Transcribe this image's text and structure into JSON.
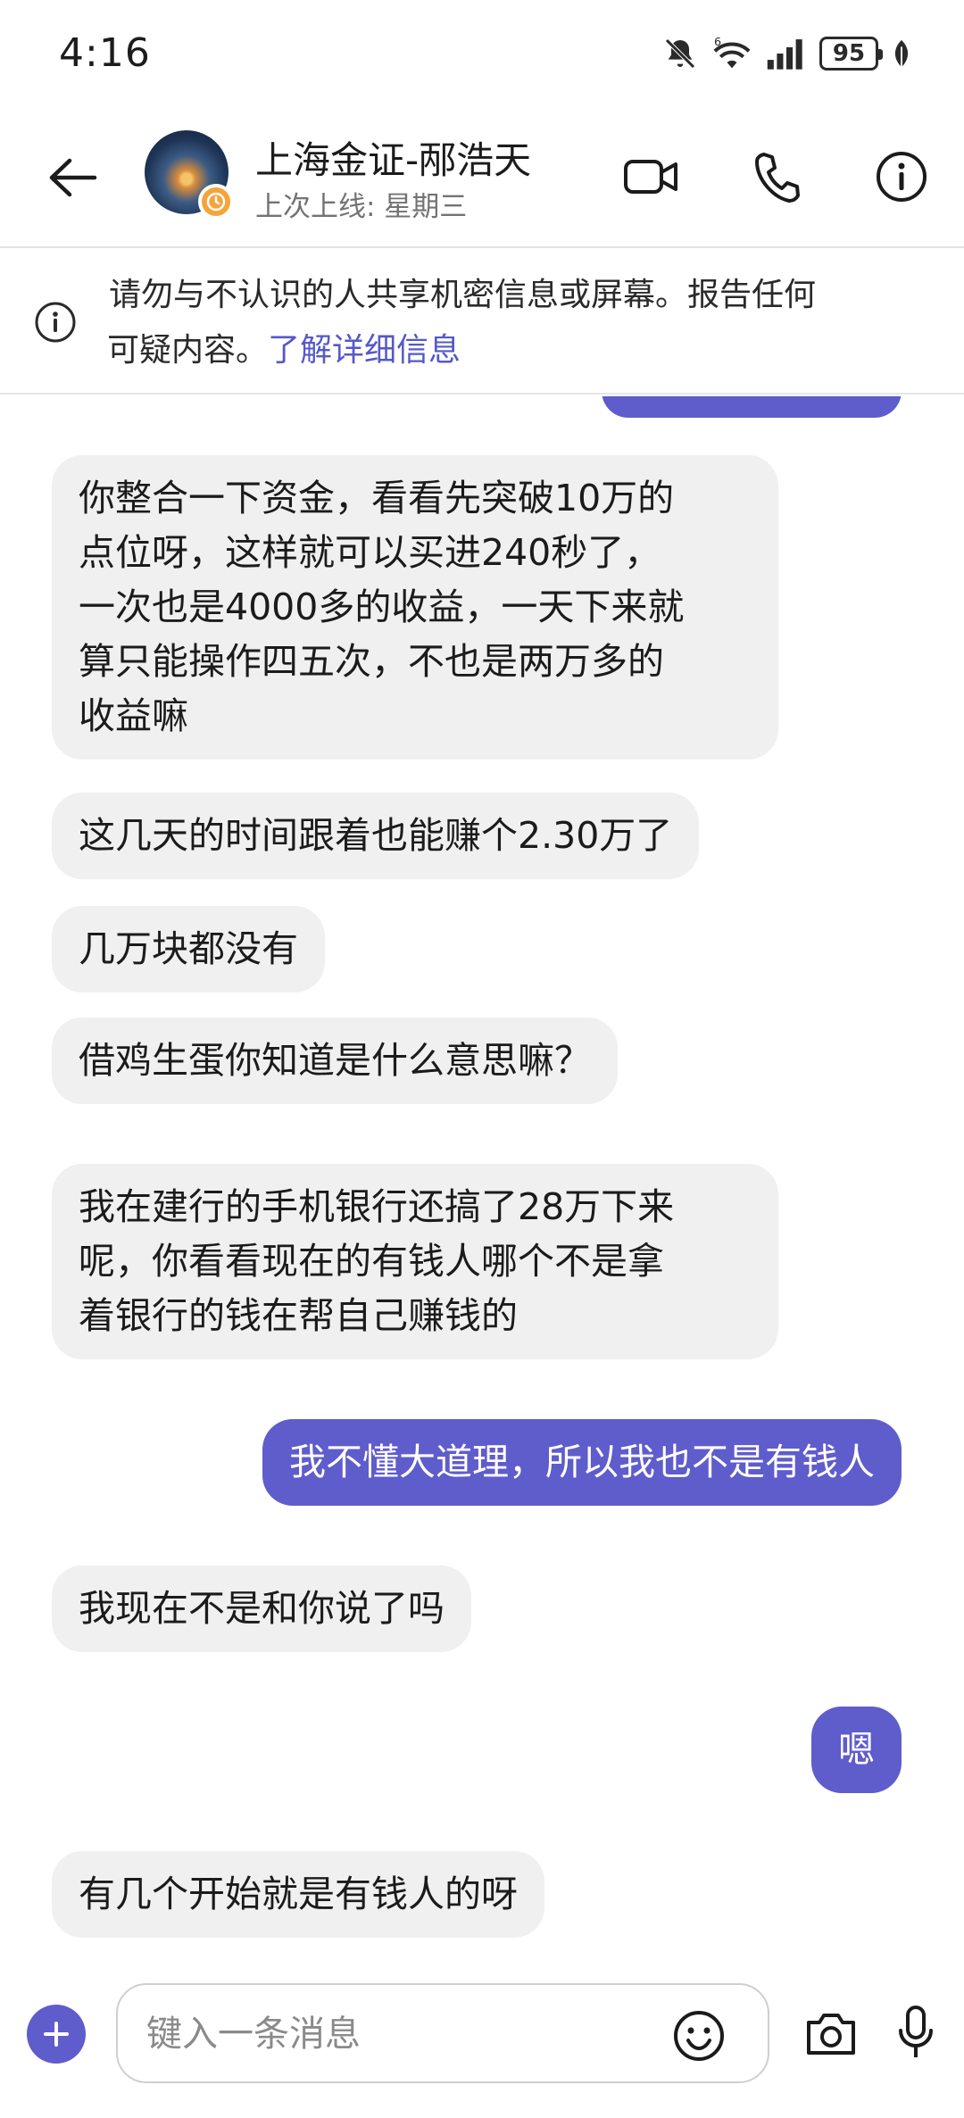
{
  "status_bar": {
    "time": "4:16",
    "battery": "95",
    "icons": [
      "mute-icon",
      "wifi-6-icon",
      "cell-signal-icon",
      "battery-icon",
      "leaf-icon"
    ]
  },
  "header": {
    "contact_name": "上海金证-邴浩天",
    "last_seen": "上次上线: 星期三",
    "icons": [
      "back-arrow-icon",
      "video-call-icon",
      "phone-icon",
      "info-icon"
    ]
  },
  "banner": {
    "text": "请勿与不认识的人共享机密信息或屏幕。报告任何可疑内容。",
    "line1": "请勿与不认识的人共享机密信息或屏幕。报告任何",
    "line2": "可疑内容。",
    "link": "了解详细信息"
  },
  "messages": [
    {
      "direction": "in",
      "lines": [
        "你整合一下资金，看看先突破10万的",
        "点位呀，这样就可以买进240秒了，",
        "一次也是4000多的收益，一天下来就",
        "算只能操作四五次，不也是两万多的",
        "收益嘛"
      ]
    },
    {
      "direction": "in",
      "lines": [
        "这几天的时间跟着也能赚个2.30万了"
      ]
    },
    {
      "direction": "in",
      "lines": [
        "几万块都没有"
      ]
    },
    {
      "direction": "in",
      "lines": [
        "借鸡生蛋你知道是什么意思嘛？"
      ]
    },
    {
      "direction": "in",
      "lines": [
        "我在建行的手机银行还搞了28万下来",
        "呢，你看看现在的有钱人哪个不是拿",
        "着银行的钱在帮自己赚钱的"
      ]
    },
    {
      "direction": "out",
      "lines": [
        "我不懂大道理，所以我也不是有钱人"
      ]
    },
    {
      "direction": "in",
      "lines": [
        "我现在不是和你说了吗"
      ]
    },
    {
      "direction": "out",
      "lines": [
        "嗯"
      ]
    },
    {
      "direction": "in",
      "lines": [
        "有几个开始就是有钱人的呀"
      ]
    }
  ],
  "composer": {
    "placeholder": "键入一条消息",
    "icons": [
      "add-icon",
      "emoji-icon",
      "camera-icon",
      "microphone-icon"
    ]
  },
  "colors": {
    "accent": "#5f5ccc",
    "incoming_bubble": "#f0f0f0",
    "link": "#5558c9"
  }
}
